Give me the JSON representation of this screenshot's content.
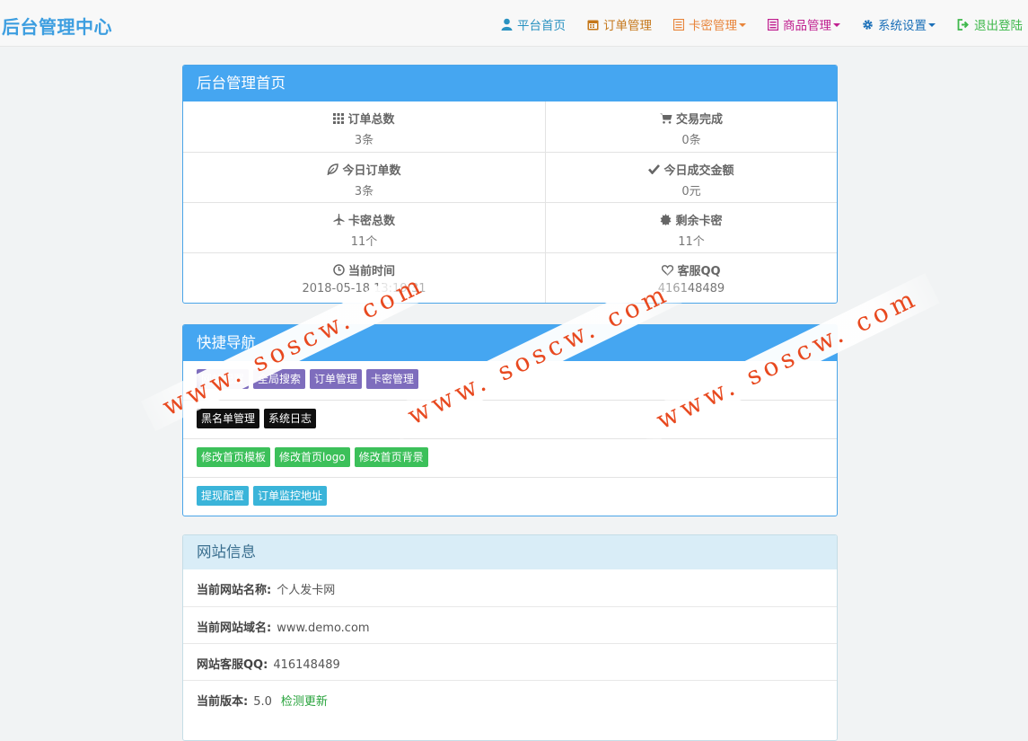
{
  "brand": "后台管理中心",
  "nav": [
    {
      "label": "平台首页",
      "icon": "user-icon",
      "color": "#2a92c1",
      "caret": false
    },
    {
      "label": "订单管理",
      "icon": "calendar-icon",
      "color": "#c5771a",
      "caret": false
    },
    {
      "label": "卡密管理",
      "icon": "list-icon",
      "color": "#e8843a",
      "caret": true
    },
    {
      "label": "商品管理",
      "icon": "book-icon",
      "color": "#c01f8f",
      "caret": true
    },
    {
      "label": "系统设置",
      "icon": "gear-icon",
      "color": "#1a6fb8",
      "caret": true
    },
    {
      "label": "退出登陆",
      "icon": "logout-icon",
      "color": "#3fb84c",
      "caret": false
    }
  ],
  "home_panel": {
    "title": "后台管理首页",
    "stats": [
      {
        "label": "订单总数",
        "value": "3条",
        "icon": "grid-icon"
      },
      {
        "label": "交易完成",
        "value": "0条",
        "icon": "cart-icon"
      },
      {
        "label": "今日订单数",
        "value": "3条",
        "icon": "leaf-icon"
      },
      {
        "label": "今日成交金额",
        "value": "0元",
        "icon": "check-icon"
      },
      {
        "label": "卡密总数",
        "value": "11个",
        "icon": "plane-icon"
      },
      {
        "label": "剩余卡密",
        "value": "11个",
        "icon": "certificate-icon"
      },
      {
        "label": "当前时间",
        "value": "2018-05-18 13:19:31",
        "icon": "clock-icon"
      },
      {
        "label": "客服QQ",
        "value": "416148489",
        "icon": "heart-icon"
      }
    ]
  },
  "quick_nav": {
    "title": "快捷导航",
    "rows": [
      [
        {
          "label": "网站配置",
          "style": "purple"
        },
        {
          "label": "全局搜索",
          "style": "purple"
        },
        {
          "label": "订单管理",
          "style": "purple"
        },
        {
          "label": "卡密管理",
          "style": "purple"
        }
      ],
      [
        {
          "label": "黑名单管理",
          "style": "black"
        },
        {
          "label": "系统日志",
          "style": "black"
        }
      ],
      [
        {
          "label": "修改首页模板",
          "style": "green"
        },
        {
          "label": "修改首页logo",
          "style": "green"
        },
        {
          "label": "修改首页背景",
          "style": "green"
        }
      ],
      [
        {
          "label": "提现配置",
          "style": "cyan"
        },
        {
          "label": "订单监控地址",
          "style": "cyan"
        }
      ]
    ]
  },
  "site_info": {
    "title": "网站信息",
    "rows": [
      {
        "label": "当前网站名称:",
        "value": "个人发卡网"
      },
      {
        "label": "当前网站域名:",
        "value": "www.demo.com"
      },
      {
        "label": "网站客服QQ:",
        "value": "416148489"
      },
      {
        "label": "当前版本:",
        "value": "5.0",
        "link": "检测更新"
      }
    ]
  },
  "watermark": "www. soscw. com"
}
